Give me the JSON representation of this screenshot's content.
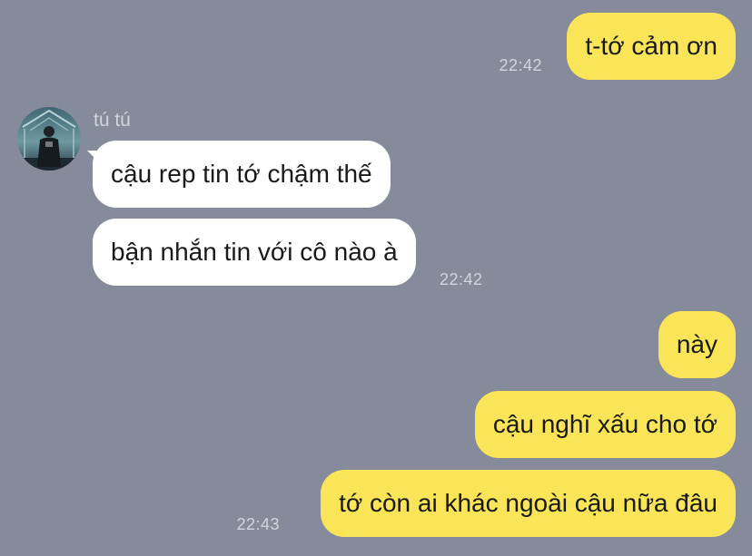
{
  "chat": {
    "sender_name": "tú tú",
    "messages": [
      {
        "from": "me",
        "text": "t-tớ cảm ơn",
        "time": "22:42"
      },
      {
        "from": "them",
        "text": "cậu rep tin tớ chậm thế"
      },
      {
        "from": "them",
        "text": "bận nhắn tin với cô nào à",
        "time": "22:42"
      },
      {
        "from": "me",
        "text": "này"
      },
      {
        "from": "me",
        "text": "cậu nghĩ xấu cho tớ"
      },
      {
        "from": "me",
        "text": "tớ còn ai khác ngoài cậu nữa đâu",
        "time": "22:43"
      }
    ]
  },
  "colors": {
    "background": "#868b9b",
    "my_bubble": "#f9e557",
    "their_bubble": "#ffffff",
    "timestamp": "#d3d5dc"
  },
  "icons": {
    "avatar": "sender-avatar-photo"
  }
}
